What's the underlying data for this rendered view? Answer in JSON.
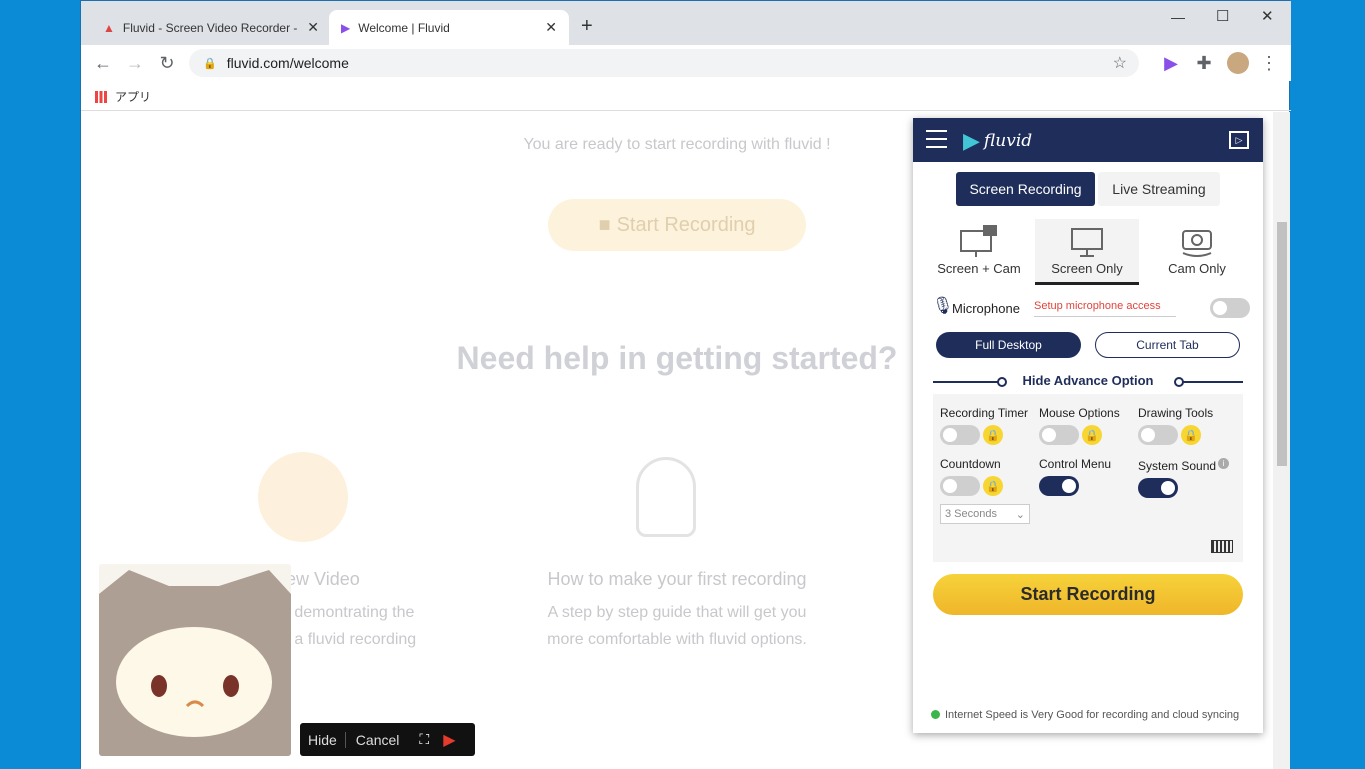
{
  "browser": {
    "tabs": [
      {
        "title": "Fluvid - Screen Video Recorder -",
        "active": false
      },
      {
        "title": "Welcome | Fluvid",
        "active": true
      }
    ],
    "new_tab": "+",
    "url": "fluvid.com/welcome",
    "bookmark_apps": "アプリ"
  },
  "page": {
    "ready_text": "You are ready to start recording with fluvid !",
    "start_button": "Start Recording",
    "help_title": "Need help in getting started?",
    "card1_title": "ew Video",
    "card1_line1": "o demontrating the",
    "card1_line2": "g a fluvid recording",
    "card2_title": "How to make your first recording",
    "card2_line1": "A step by step guide that will get you",
    "card2_line2": "more comfortable with fluvid options."
  },
  "cam_controls": {
    "hide": "Hide",
    "cancel": "Cancel"
  },
  "panel": {
    "logo": "fluvid",
    "tabs": [
      "Screen Recording",
      "Live Streaming"
    ],
    "modes": [
      "Screen + Cam",
      "Screen Only",
      "Cam Only"
    ],
    "selected_mode": "Screen Only",
    "microphone_label": "Microphone",
    "microphone_setup": "Setup microphone access",
    "microphone_enabled": false,
    "capture": [
      "Full Desktop",
      "Current Tab"
    ],
    "advance_toggle": "Hide Advance Option",
    "options": {
      "recording_timer": {
        "label": "Recording Timer",
        "on": false,
        "locked": true
      },
      "mouse_options": {
        "label": "Mouse Options",
        "on": false,
        "locked": true
      },
      "drawing_tools": {
        "label": "Drawing Tools",
        "on": false,
        "locked": true
      },
      "countdown": {
        "label": "Countdown",
        "on": false,
        "locked": true
      },
      "control_menu": {
        "label": "Control Menu",
        "on": true
      },
      "system_sound": {
        "label": "System Sound",
        "on": true
      }
    },
    "countdown_select": "3 Seconds",
    "start_button": "Start Recording",
    "status": "Internet Speed is Very Good for recording and cloud syncing",
    "status_color": "#3cb54a",
    "accent": "#1f2d5a",
    "button_color": "#f3c22b"
  }
}
